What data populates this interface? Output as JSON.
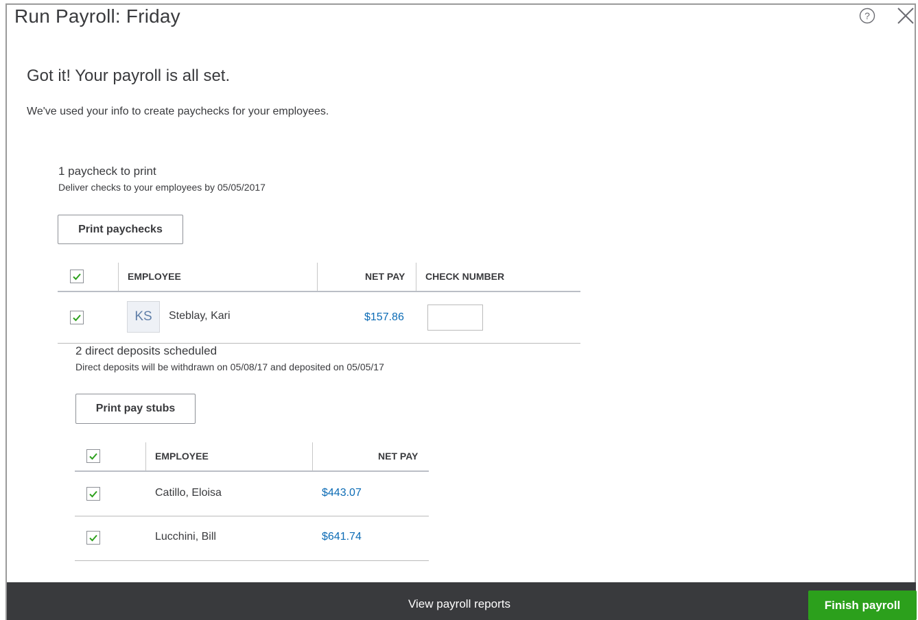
{
  "dialog": {
    "title": "Run Payroll: Friday",
    "headline": "Got it! Your payroll is all set.",
    "subline": "We've used your info to create paychecks for your employees."
  },
  "paychecks": {
    "title": "1 paycheck to print",
    "subtitle": "Deliver checks to your employees by 05/05/2017",
    "print_button": "Print paychecks",
    "columns": {
      "employee": "EMPLOYEE",
      "net_pay": "NET PAY",
      "check_number": "CHECK NUMBER"
    },
    "rows": [
      {
        "initials": "KS",
        "employee": "Steblay, Kari",
        "net_pay": "$157.86",
        "check_number": "",
        "checked": true
      }
    ]
  },
  "direct_deposits": {
    "title": "2 direct deposits scheduled",
    "subtitle": "Direct deposits will be withdrawn on 05/08/17 and deposited on 05/05/17",
    "print_button": "Print pay stubs",
    "columns": {
      "employee": "EMPLOYEE",
      "net_pay": "NET PAY"
    },
    "rows": [
      {
        "employee": "Catillo, Eloisa",
        "net_pay": "$443.07",
        "checked": true
      },
      {
        "employee": "Lucchini, Bill",
        "net_pay": "$641.74",
        "checked": true
      }
    ]
  },
  "footer": {
    "reports_link": "View payroll reports",
    "finish_button": "Finish payroll"
  },
  "colors": {
    "accent_green": "#2ca01c",
    "link_blue": "#0b6bb5",
    "footer_bg": "#393a3d",
    "check_green": "#2ca01c"
  },
  "icons": {
    "help": "help-circle-icon",
    "close": "close-icon",
    "checkbox": "checkmark-icon"
  }
}
